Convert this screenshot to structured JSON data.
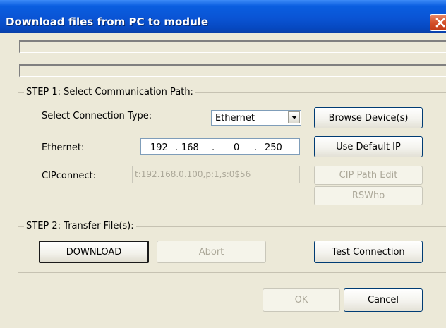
{
  "window": {
    "title": "Download files from PC to module"
  },
  "step1": {
    "caption": "STEP 1: Select Communication Path:",
    "connection_type_label": "Select Connection Type:",
    "connection_type_value": "Ethernet",
    "browse_button": "Browse Device(s)",
    "ethernet_label": "Ethernet:",
    "ip": [
      "192",
      "168",
      "0",
      "250"
    ],
    "ip_separator": ".",
    "use_default_ip_button": "Use Default IP",
    "cipconnect_label": "CIPconnect:",
    "cipconnect_value": "t:192.168.0.100,p:1,s:0$56",
    "cip_path_edit_button": "CIP Path Edit",
    "rswho_button": "RSWho"
  },
  "step2": {
    "caption": "STEP 2: Transfer File(s):",
    "download_button": "DOWNLOAD",
    "abort_button": "Abort",
    "test_connection_button": "Test Connection"
  },
  "footer": {
    "ok_button": "OK",
    "cancel_button": "Cancel"
  }
}
